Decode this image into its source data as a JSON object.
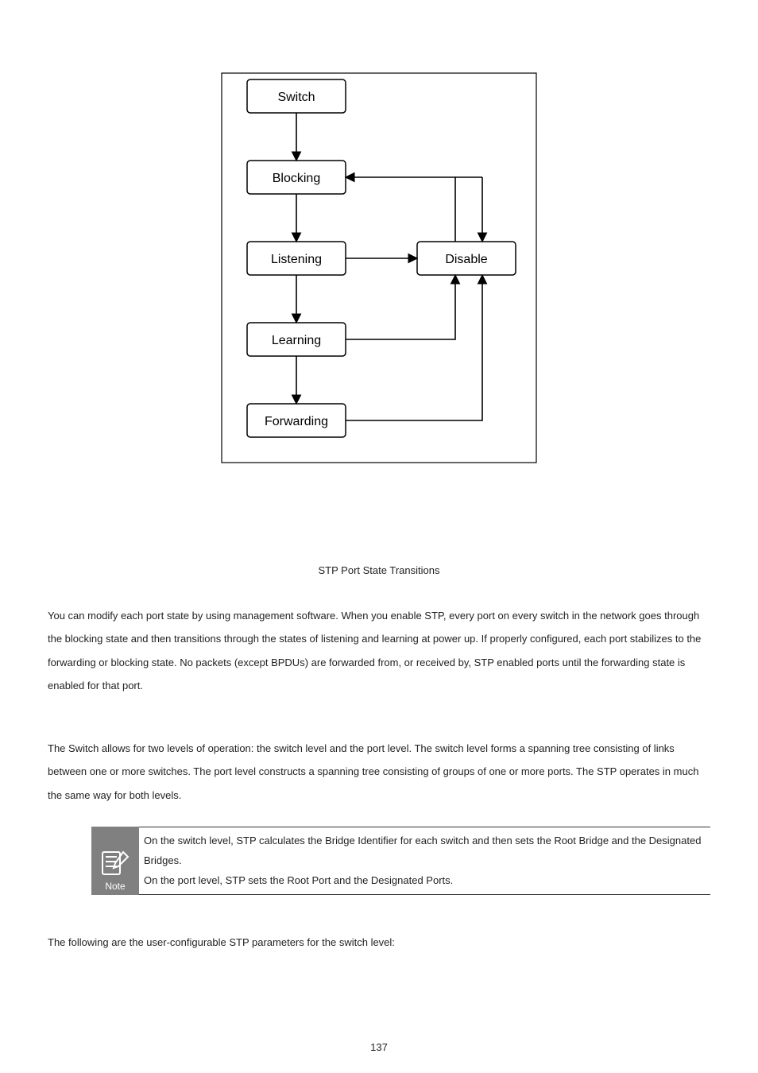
{
  "diagram": {
    "nodes": {
      "switch": "Switch",
      "blocking": "Blocking",
      "listening": "Listening",
      "learning": "Learning",
      "forwarding": "Forwarding",
      "disable": "Disable"
    },
    "caption": "STP Port State Transitions"
  },
  "paragraphs": {
    "p1": "You can modify each port state by using management software. When you enable STP, every port on every switch in the network goes through the blocking state and then transitions through the states of listening and learning at power up. If properly configured, each port stabilizes to the forwarding or blocking state. No packets (except BPDUs) are forwarded from, or received by, STP enabled ports until the forwarding state is enabled for that port.",
    "p2": "The Switch allows for two levels of operation: the switch level and the port level. The switch level forms a spanning tree consisting of links between one or more switches. The port level constructs a spanning tree consisting of groups of one or more ports. The STP operates in much the same way for both levels.",
    "p3": "The following are the user-configurable STP parameters for the switch level:"
  },
  "note": {
    "label": "Note",
    "line1": "On the switch level, STP calculates the Bridge Identifier for each switch and then sets the Root Bridge and the Designated Bridges.",
    "line2": "On the port level, STP sets the Root Port and the Designated Ports."
  },
  "pageNumber": "137"
}
